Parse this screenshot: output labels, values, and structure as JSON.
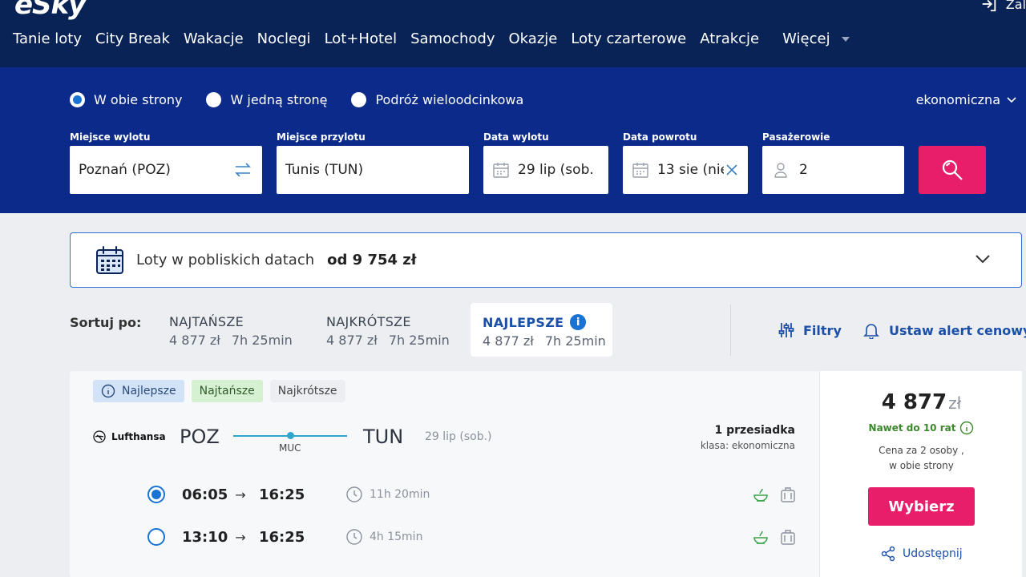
{
  "header": {
    "logo": "eSky",
    "login_label": "Zal",
    "nav": [
      "Tanie loty",
      "City Break",
      "Wakacje",
      "Noclegi",
      "Lot+Hotel",
      "Samochody",
      "Okazje",
      "Loty czarterowe",
      "Atrakcje"
    ],
    "more_label": "Więcej"
  },
  "search": {
    "trip_types": [
      {
        "label": "W obie strony",
        "selected": true
      },
      {
        "label": "W jedną stronę",
        "selected": false
      },
      {
        "label": "Podróż wieloodcinkowa",
        "selected": false
      }
    ],
    "cabin_class": "ekonomiczna",
    "from": {
      "label": "Miejsce wylotu",
      "value": "Poznań (POZ)"
    },
    "to": {
      "label": "Miejsce przylotu",
      "value": "Tunis (TUN)"
    },
    "departure": {
      "label": "Data wylotu",
      "value": "29 lip (sob."
    },
    "return": {
      "label": "Data powrotu",
      "value": "13 sie (niec"
    },
    "passengers": {
      "label": "Pasażerowie",
      "value": "2"
    }
  },
  "nearby_dates": {
    "text": "Loty w pobliskich datach",
    "price": "od 9 754 zł"
  },
  "sort": {
    "label": "Sortuj po:",
    "options": [
      {
        "title": "NAJTAŃSZE",
        "price": "4 877 zł",
        "duration": "7h 25min",
        "active": false
      },
      {
        "title": "NAJKRÓTSZE",
        "price": "4 877 zł",
        "duration": "7h 25min",
        "active": false
      },
      {
        "title": "NAJLEPSZE",
        "price": "4 877 zł",
        "duration": "7h 25min",
        "active": true
      }
    ],
    "filters_label": "Filtry",
    "alert_label": "Ustaw alert cenowy"
  },
  "result": {
    "badges": {
      "best": "Najlepsze",
      "cheapest": "Najtańsze",
      "shortest": "Najkrótsze"
    },
    "airline": "Lufthansa",
    "from_code": "POZ",
    "to_code": "TUN",
    "stop_code": "MUC",
    "date": "29 lip (sob.)",
    "stops": "1 przesiadka",
    "class": "klasa: ekonomiczna",
    "options": [
      {
        "dep": "06:05",
        "arr": "16:25",
        "duration": "11h 20min",
        "selected": true
      },
      {
        "dep": "13:10",
        "arr": "16:25",
        "duration": "4h 15min",
        "selected": false
      }
    ],
    "price": "4 877",
    "currency": "zł",
    "installments": "Nawet do 10 rat",
    "price_note_1": "Cena za 2 osoby ,",
    "price_note_2": "w obie strony",
    "select_label": "Wybierz",
    "share_label": "Udostępnij"
  },
  "colors": {
    "navy": "#0a2357",
    "search_blue": "#0b2a8a",
    "pink": "#e81e6b",
    "link_blue": "#1b4fa8",
    "route": "#2ea6c9"
  }
}
